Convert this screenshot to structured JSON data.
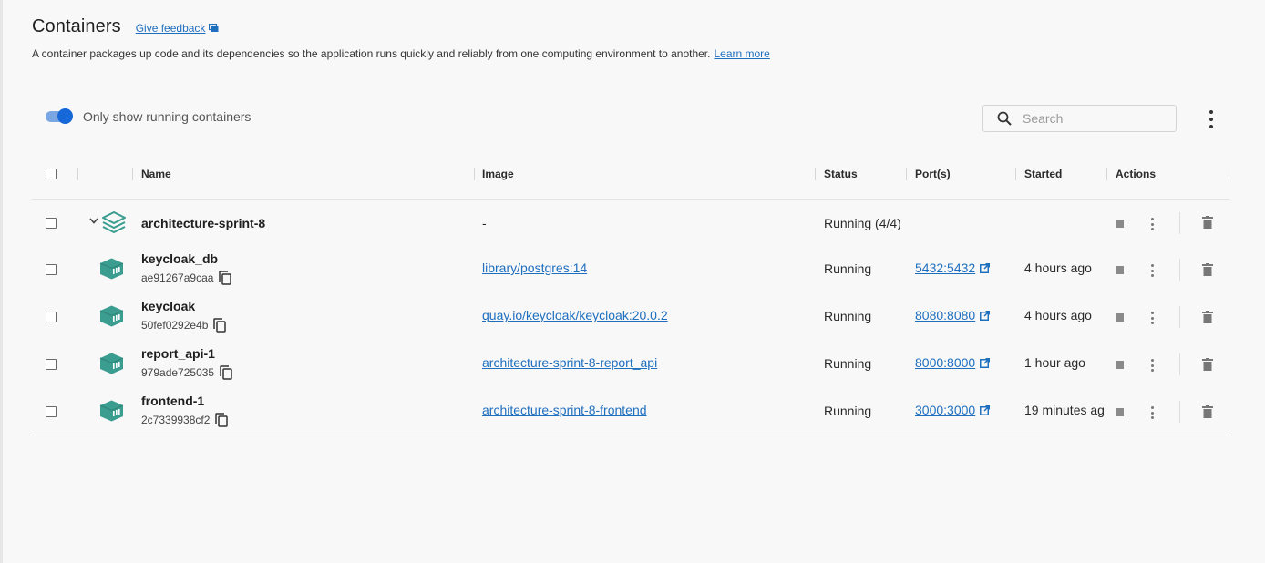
{
  "page": {
    "title": "Containers",
    "feedback_label": "Give feedback",
    "description": "A container packages up code and its dependencies so the application runs quickly and reliably from one computing environment to another.",
    "learn_more": "Learn more"
  },
  "toolbar": {
    "toggle_label": "Only show running containers",
    "toggle_on": true,
    "search_placeholder": "Search"
  },
  "columns": {
    "name": "Name",
    "image": "Image",
    "status": "Status",
    "ports": "Port(s)",
    "started": "Started",
    "actions": "Actions"
  },
  "group": {
    "name": "architecture-sprint-8",
    "image": "-",
    "status": "Running (4/4)"
  },
  "containers": [
    {
      "name": "keycloak_db",
      "id": "ae91267a9caa",
      "image": "library/postgres:14",
      "status": "Running",
      "port": "5432:5432",
      "started": "4 hours ago"
    },
    {
      "name": "keycloak",
      "id": "50fef0292e4b",
      "image": "quay.io/keycloak/keycloak:20.0.2",
      "status": "Running",
      "port": "8080:8080",
      "started": "4 hours ago"
    },
    {
      "name": "report_api-1",
      "id": "979ade725035",
      "image": "architecture-sprint-8-report_api",
      "status": "Running",
      "port": "8000:8000",
      "started": "1 hour ago"
    },
    {
      "name": "frontend-1",
      "id": "2c7339938cf2",
      "image": "architecture-sprint-8-frontend",
      "status": "Running",
      "port": "3000:3000",
      "started": "19 minutes ag"
    }
  ],
  "colors": {
    "accent": "#1668d9",
    "link": "#1f6fbf",
    "container_icon": "#3a9d8f"
  },
  "icons": {
    "feedback": "feedback-icon",
    "search": "search-icon",
    "menu": "kebab-icon",
    "group": "stack-icon",
    "container": "container-icon",
    "copy": "copy-icon",
    "external": "external-link-icon",
    "stop": "stop-icon",
    "delete": "trash-icon",
    "expand": "chevron-down-icon"
  }
}
